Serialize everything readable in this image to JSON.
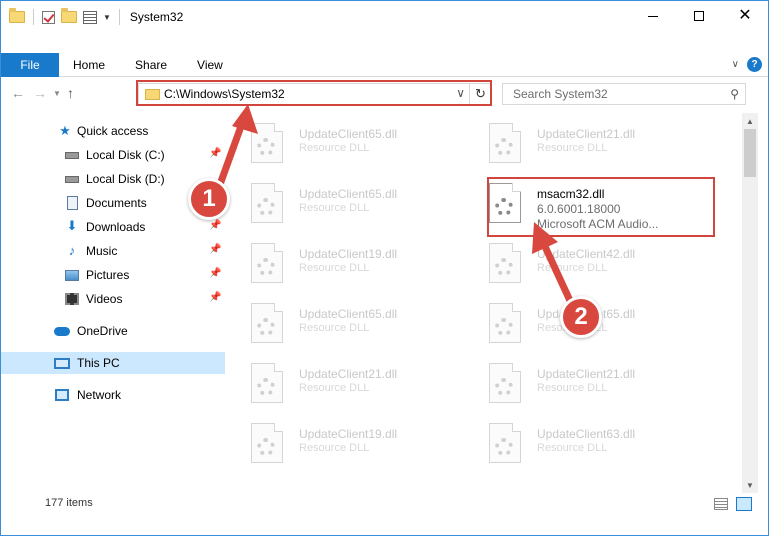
{
  "window": {
    "title": "System32",
    "accent": "#1979ca"
  },
  "ribbon": {
    "tabs": [
      {
        "label": "File"
      },
      {
        "label": "Home"
      },
      {
        "label": "Share"
      },
      {
        "label": "View"
      }
    ],
    "help": "?"
  },
  "navigation": {
    "address": "C:\\Windows\\System32",
    "search_placeholder": "Search System32"
  },
  "sidebar": {
    "items": [
      {
        "label": "Quick access",
        "icon": "star-icon"
      },
      {
        "label": "Local Disk (C:)",
        "icon": "drive-icon",
        "pinned": true
      },
      {
        "label": "Local Disk (D:)",
        "icon": "drive-icon",
        "pinned": false
      },
      {
        "label": "Documents",
        "icon": "documents-icon",
        "pinned": true
      },
      {
        "label": "Downloads",
        "icon": "downloads-icon",
        "pinned": true
      },
      {
        "label": "Music",
        "icon": "music-icon",
        "pinned": true
      },
      {
        "label": "Pictures",
        "icon": "pictures-icon",
        "pinned": true
      },
      {
        "label": "Videos",
        "icon": "videos-icon",
        "pinned": true
      },
      {
        "label": "OneDrive",
        "icon": "onedrive-icon"
      },
      {
        "label": "This PC",
        "icon": "this-pc-icon",
        "selected": true
      },
      {
        "label": "Network",
        "icon": "network-icon"
      }
    ]
  },
  "files": [
    {
      "name": "UpdateClient65.dll",
      "type": "Resource DLL"
    },
    {
      "name": "UpdateClient21.dll",
      "type": "Resource DLL"
    },
    {
      "name": "UpdateClient65.dll",
      "type": "Resource DLL"
    },
    {
      "name": "msacm32.dll",
      "type": "6.0.6001.18000",
      "description": "Microsoft ACM Audio...",
      "selected": true
    },
    {
      "name": "UpdateClient19.dll",
      "type": "Resource DLL"
    },
    {
      "name": "UpdateClient42.dll",
      "type": "Resource DLL"
    },
    {
      "name": "UpdateClient65.dll",
      "type": "Resource DLL"
    },
    {
      "name": "UpdateClient65.dll",
      "type": "Resource DLL"
    },
    {
      "name": "UpdateClient21.dll",
      "type": "Resource DLL"
    },
    {
      "name": "UpdateClient21.dll",
      "type": "Resource DLL"
    },
    {
      "name": "UpdateClient19.dll",
      "type": "Resource DLL"
    },
    {
      "name": "UpdateClient63.dll",
      "type": "Resource DLL"
    }
  ],
  "status": {
    "item_count": "177 items"
  },
  "annotations": {
    "step1": "1",
    "step2": "2",
    "highlight_color": "#d0453c"
  }
}
